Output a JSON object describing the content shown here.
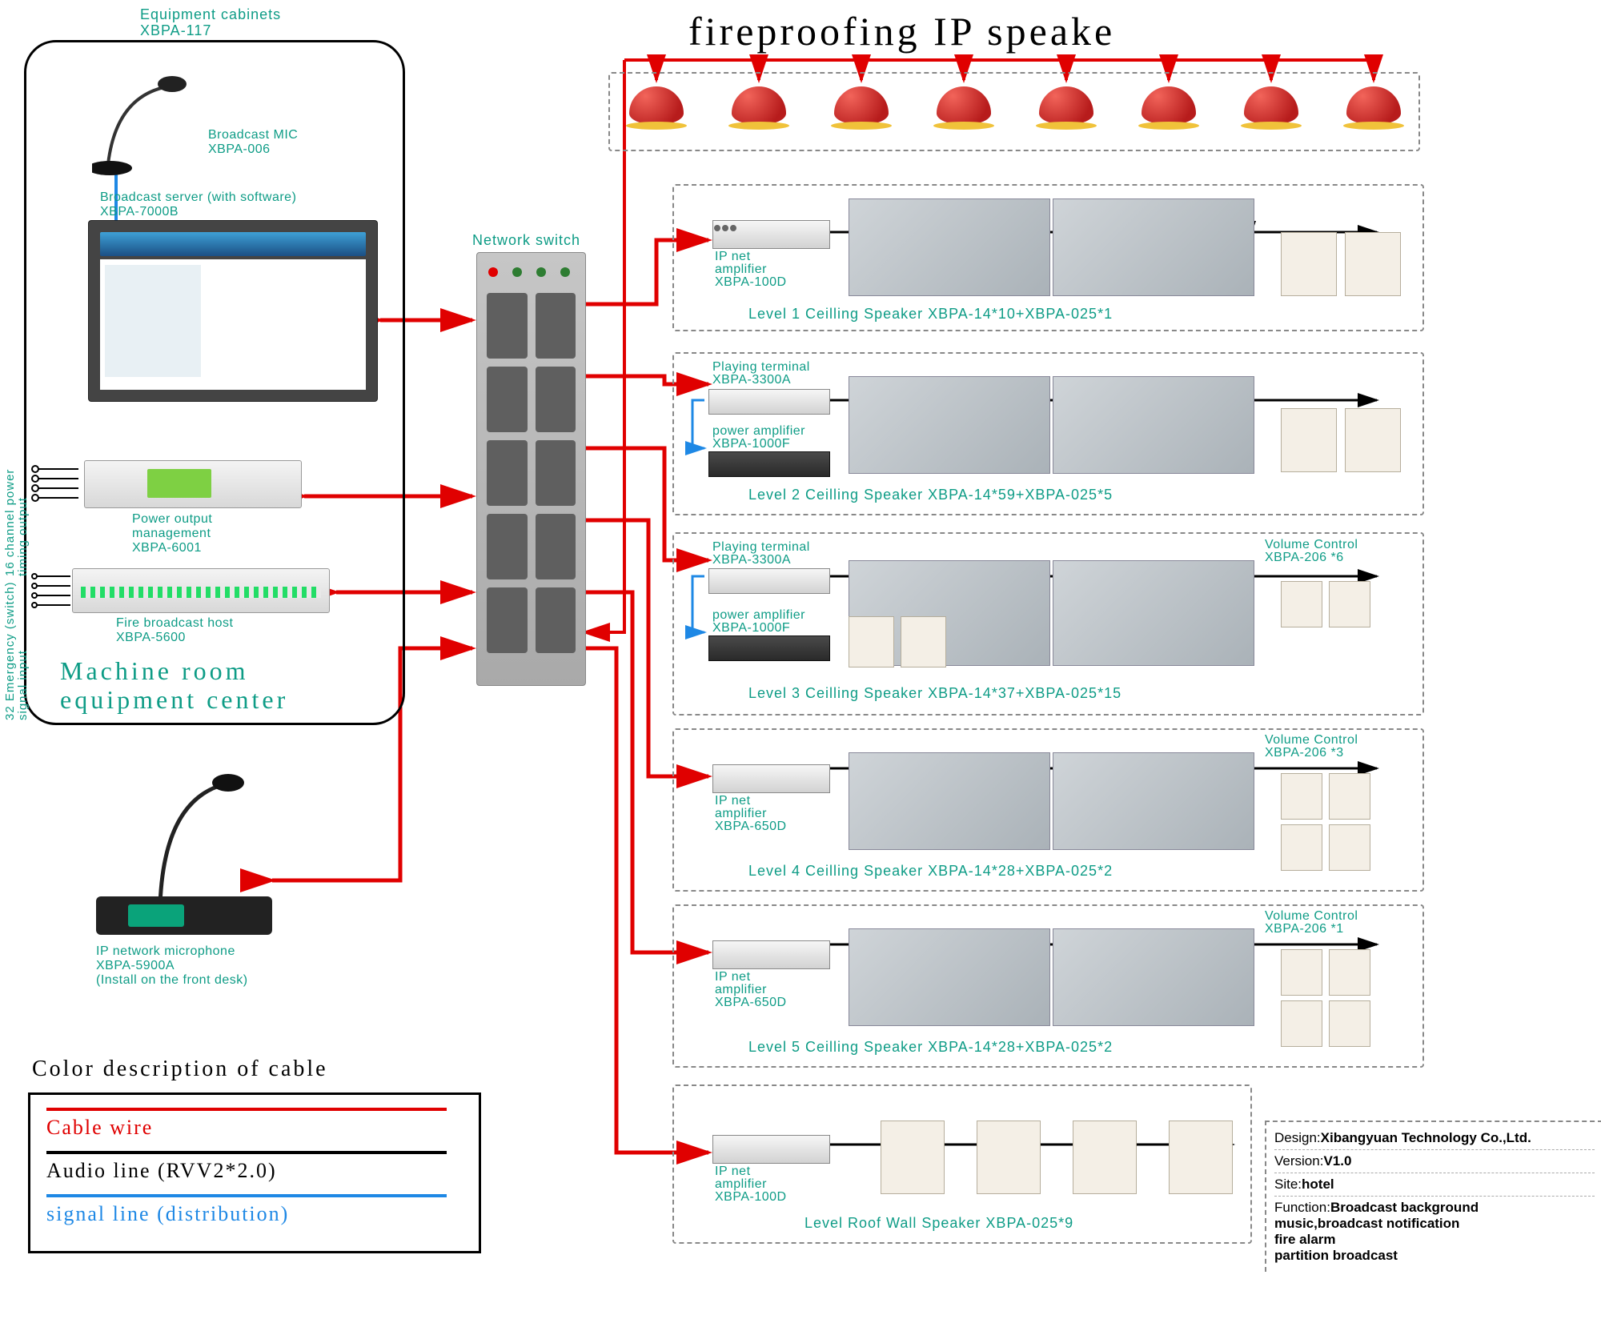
{
  "header": {
    "fireproof_title": "fireproofing  IP speake"
  },
  "cabinet": {
    "title_top": "Equipment cabinets",
    "title_model": "XBPA-117",
    "mic": {
      "line1": "Broadcast MIC",
      "line2": "XBPA-006"
    },
    "server": {
      "line1": "Broadcast server (with software)",
      "line2": "XBPA-7000B"
    },
    "power_mgmt": {
      "line1": "Power output",
      "line2": "management",
      "line3": "XBPA-6001"
    },
    "fire_host": {
      "line1": "Fire broadcast host",
      "line2": "XBPA-5600"
    },
    "center_line1": "Machine room",
    "center_line2": "equipment center",
    "side_left_1": "16 channel power",
    "side_left_1b": "timing output",
    "side_left_2": "32 Emergency (switch)",
    "side_left_2b": "signal input"
  },
  "switch": {
    "label": "Network switch"
  },
  "front_mic": {
    "line1": "IP network microphone",
    "line2": "XBPA-5900A",
    "line3": "(Install on the front desk)"
  },
  "legend": {
    "title": "Color description of cable",
    "cable": "Cable wire",
    "audio": "Audio line (RVV2*2.0)",
    "signal": "signal line (distribution)"
  },
  "levels": [
    {
      "amp_label1": "IP net",
      "amp_label2": "amplifier",
      "amp_label3": "XBPA-100D",
      "caption": "Level 1 Ceilling Speaker  XBPA-14*10+XBPA-025*1",
      "volume": ""
    },
    {
      "term_label1": "Playing terminal",
      "term_label2": "XBPA-3300A",
      "amp_label1": "power amplifier",
      "amp_label2": "XBPA-1000F",
      "caption": "Level 2 Ceilling Speaker  XBPA-14*59+XBPA-025*5",
      "volume": ""
    },
    {
      "term_label1": "Playing terminal",
      "term_label2": "XBPA-3300A",
      "amp_label1": "power amplifier",
      "amp_label2": "XBPA-1000F",
      "caption": "Level 3 Ceilling Speaker  XBPA-14*37+XBPA-025*15",
      "volume_l1": "Volume Control",
      "volume_l2": "XBPA-206 *6"
    },
    {
      "amp_label1": "IP net",
      "amp_label2": "amplifier",
      "amp_label3": "XBPA-650D",
      "caption": "Level 4 Ceilling Speaker  XBPA-14*28+XBPA-025*2",
      "volume_l1": "Volume Control",
      "volume_l2": "XBPA-206 *3"
    },
    {
      "amp_label1": "IP net",
      "amp_label2": "amplifier",
      "amp_label3": "XBPA-650D",
      "caption": "Level 5 Ceilling Speaker  XBPA-14*28+XBPA-025*2",
      "volume_l1": "Volume Control",
      "volume_l2": "XBPA-206 *1"
    },
    {
      "amp_label1": "IP net",
      "amp_label2": "amplifier",
      "amp_label3": "XBPA-100D",
      "caption": "Level Roof  Wall Speaker  XBPA-025*9",
      "volume": ""
    }
  ],
  "info": {
    "design_k": "Design:",
    "design_v": "Xibangyuan Technology Co.,Ltd.",
    "version_k": "Version:",
    "version_v": "V1.0",
    "site_k": "Site:",
    "site_v": "hotel",
    "function_k": "Function:",
    "function_v1": "Broadcast background",
    "function_v2": "music,broadcast notification",
    "function_v3": "fire alarm",
    "function_v4": "partition broadcast"
  }
}
